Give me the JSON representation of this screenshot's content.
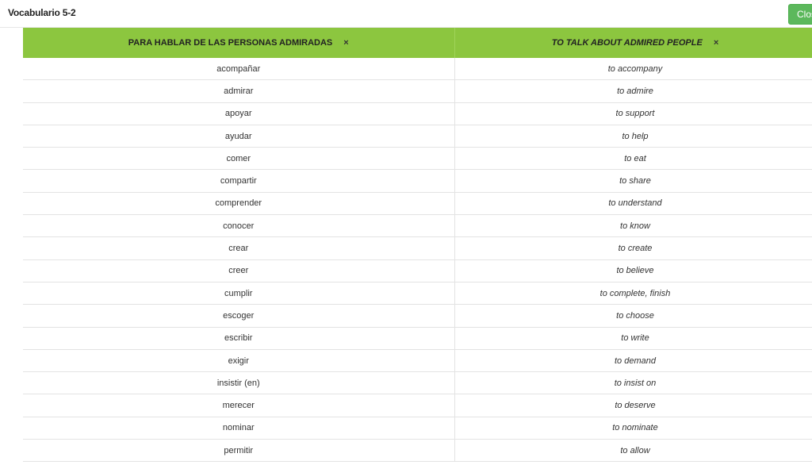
{
  "header": {
    "title": "Vocabulario 5-2",
    "close_label": "Close"
  },
  "table": {
    "columns": [
      {
        "label": "PARA HABLAR DE LAS PERSONAS ADMIRADAS",
        "remove_icon": "×"
      },
      {
        "label": "TO TALK ABOUT ADMIRED PEOPLE",
        "remove_icon": "×"
      }
    ],
    "rows": [
      {
        "es": "acompañar",
        "en": "to accompany"
      },
      {
        "es": "admirar",
        "en": "to admire"
      },
      {
        "es": "apoyar",
        "en": "to support"
      },
      {
        "es": "ayudar",
        "en": "to help"
      },
      {
        "es": "comer",
        "en": "to eat"
      },
      {
        "es": "compartir",
        "en": "to share"
      },
      {
        "es": "comprender",
        "en": "to understand"
      },
      {
        "es": "conocer",
        "en": "to know"
      },
      {
        "es": "crear",
        "en": "to create"
      },
      {
        "es": "creer",
        "en": "to believe"
      },
      {
        "es": "cumplir",
        "en": "to complete, finish"
      },
      {
        "es": "escoger",
        "en": "to choose"
      },
      {
        "es": "escribir",
        "en": "to write"
      },
      {
        "es": "exigir",
        "en": "to demand"
      },
      {
        "es": "insistir (en)",
        "en": "to insist on"
      },
      {
        "es": "merecer",
        "en": "to deserve"
      },
      {
        "es": "nominar",
        "en": "to nominate"
      },
      {
        "es": "permitir",
        "en": "to allow"
      }
    ]
  },
  "colors": {
    "header_green": "#8cc63f",
    "close_button_green": "#5cb85c"
  }
}
